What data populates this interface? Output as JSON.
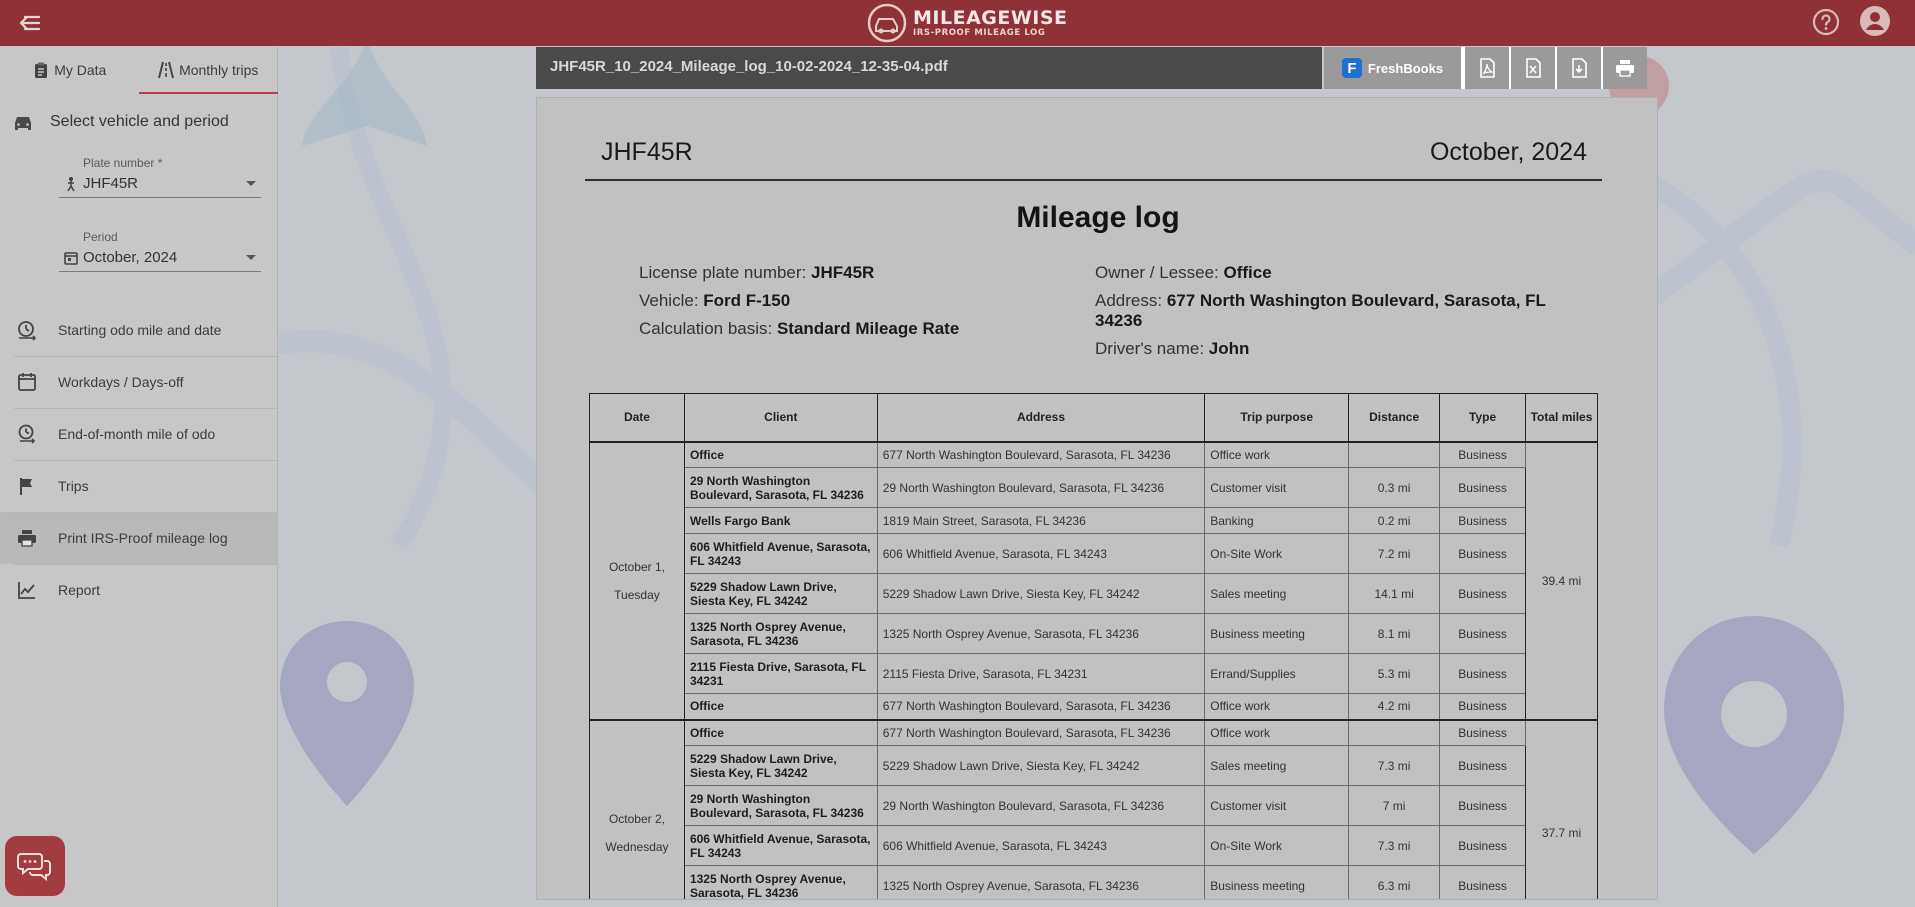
{
  "app": {
    "logo_title": "MILEAGEWISE",
    "logo_subtitle": "IRS-PROOF MILEAGE LOG"
  },
  "sidebar": {
    "tabs": [
      {
        "label": "My Data",
        "icon": "clipboard-icon"
      },
      {
        "label": "Monthly trips",
        "icon": "road-icon",
        "active": true
      }
    ],
    "select_heading": "Select vehicle and period",
    "plate": {
      "label": "Plate number *",
      "value": "JHF45R"
    },
    "period": {
      "label": "Period",
      "value": "October, 2024"
    },
    "nav": [
      {
        "label": "Starting odo mile and date",
        "icon": "odometer-start-icon"
      },
      {
        "label": "Workdays / Days-off",
        "icon": "calendar-icon"
      },
      {
        "label": "End-of-month mile of odo",
        "icon": "odometer-end-icon"
      },
      {
        "label": "Trips",
        "icon": "flag-icon"
      },
      {
        "label": "Print IRS-Proof mileage log",
        "icon": "print-icon",
        "active": true
      },
      {
        "label": "Report",
        "icon": "chart-line-icon"
      }
    ]
  },
  "viewer": {
    "filename": "JHF45R_10_2024_Mileage_log_10-02-2024_12-35-04.pdf",
    "freshbooks_label": "FreshBooks",
    "toolbar_icons": [
      "pdf-icon",
      "excel-icon",
      "file-export-icon",
      "print-icon"
    ]
  },
  "document": {
    "plate": "JHF45R",
    "month": "October, 2024",
    "title": "Mileage log",
    "license_label": "License plate number: ",
    "license_value": "JHF45R",
    "vehicle_label": "Vehicle: ",
    "vehicle_value": "Ford F-150",
    "basis_label": "Calculation basis: ",
    "basis_value": "Standard Mileage Rate",
    "owner_label": "Owner / Lessee: ",
    "owner_value": "Office",
    "address_label": "Address: ",
    "address_value": "677 North Washington Boulevard, Sarasota, FL 34236",
    "driver_label": "Driver's name: ",
    "driver_value": "John",
    "columns": [
      "Date",
      "Client",
      "Address",
      "Trip purpose",
      "Distance",
      "Type",
      "Total miles"
    ],
    "days": [
      {
        "date": "October 1,",
        "weekday": "Tuesday",
        "total": "39.4 mi",
        "trips": [
          {
            "client": "Office",
            "address": "677 North Washington Boulevard, Sarasota, FL 34236",
            "purpose": "Office work",
            "distance": "",
            "type": "Business"
          },
          {
            "client": "29 North Washington Boulevard, Sarasota, FL 34236",
            "address": "29 North Washington Boulevard, Sarasota, FL 34236",
            "purpose": "Customer visit",
            "distance": "0.3 mi",
            "type": "Business"
          },
          {
            "client": "Wells Fargo Bank",
            "address": "1819 Main Street, Sarasota, FL 34236",
            "purpose": "Banking",
            "distance": "0.2 mi",
            "type": "Business"
          },
          {
            "client": "606 Whitfield Avenue, Sarasota, FL 34243",
            "address": "606 Whitfield Avenue, Sarasota, FL 34243",
            "purpose": "On-Site Work",
            "distance": "7.2 mi",
            "type": "Business"
          },
          {
            "client": "5229 Shadow Lawn Drive, Siesta Key, FL 34242",
            "address": "5229 Shadow Lawn Drive, Siesta Key, FL 34242",
            "purpose": "Sales meeting",
            "distance": "14.1 mi",
            "type": "Business"
          },
          {
            "client": "1325 North Osprey Avenue, Sarasota, FL 34236",
            "address": "1325 North Osprey Avenue, Sarasota, FL 34236",
            "purpose": "Business meeting",
            "distance": "8.1 mi",
            "type": "Business"
          },
          {
            "client": "2115 Fiesta Drive, Sarasota, FL 34231",
            "address": "2115 Fiesta Drive, Sarasota, FL 34231",
            "purpose": "Errand/Supplies",
            "distance": "5.3 mi",
            "type": "Business"
          },
          {
            "client": "Office",
            "address": "677 North Washington Boulevard, Sarasota, FL 34236",
            "purpose": "Office work",
            "distance": "4.2 mi",
            "type": "Business"
          }
        ]
      },
      {
        "date": "October 2,",
        "weekday": "Wednesday",
        "total": "37.7 mi",
        "trips": [
          {
            "client": "Office",
            "address": "677 North Washington Boulevard, Sarasota, FL 34236",
            "purpose": "Office work",
            "distance": "",
            "type": "Business"
          },
          {
            "client": "5229 Shadow Lawn Drive, Siesta Key, FL 34242",
            "address": "5229 Shadow Lawn Drive, Siesta Key, FL 34242",
            "purpose": "Sales meeting",
            "distance": "7.3 mi",
            "type": "Business"
          },
          {
            "client": "29 North Washington Boulevard, Sarasota, FL 34236",
            "address": "29 North Washington Boulevard, Sarasota, FL 34236",
            "purpose": "Customer visit",
            "distance": "7 mi",
            "type": "Business"
          },
          {
            "client": "606 Whitfield Avenue, Sarasota, FL 34243",
            "address": "606 Whitfield Avenue, Sarasota, FL 34243",
            "purpose": "On-Site Work",
            "distance": "7.3 mi",
            "type": "Business"
          },
          {
            "client": "1325 North Osprey Avenue, Sarasota, FL 34236",
            "address": "1325 North Osprey Avenue, Sarasota, FL 34236",
            "purpose": "Business meeting",
            "distance": "6.3 mi",
            "type": "Business"
          },
          {
            "client": "",
            "address": "",
            "purpose": "",
            "distance": "",
            "type": ""
          }
        ]
      }
    ]
  }
}
